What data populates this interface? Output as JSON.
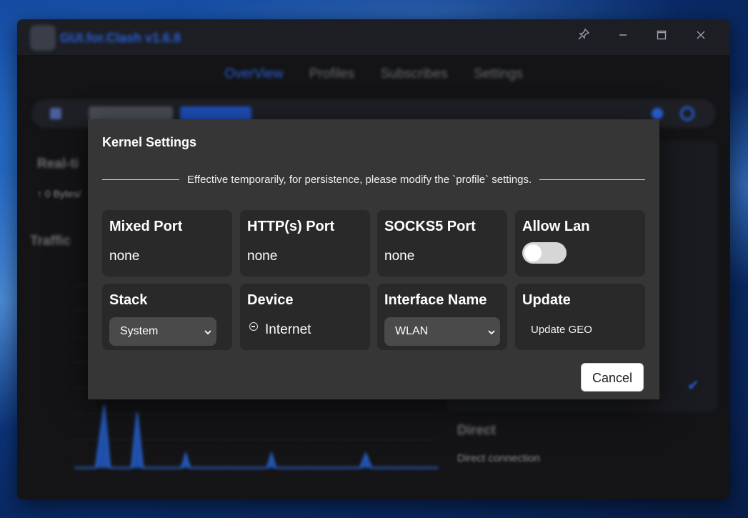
{
  "app": {
    "title": "GUI.for.Clash v1.6.8",
    "window_buttons": [
      "pin-icon",
      "minimize-icon",
      "maximize-icon",
      "close-icon"
    ]
  },
  "nav": {
    "tabs": [
      {
        "label": "OverView",
        "active": true
      },
      {
        "label": "Profiles",
        "active": false
      },
      {
        "label": "Subscribes",
        "active": false
      },
      {
        "label": "Settings",
        "active": false
      }
    ]
  },
  "background": {
    "realtime_heading": "Real-ti",
    "realtime_stat": "↑ 0 Bytes/",
    "traffic_heading": "Traffic",
    "direct_heading": "Direct",
    "direct_sub": "Direct connection"
  },
  "dialog": {
    "title": "Kernel Settings",
    "notice": "Effective temporarily, for persistence, please modify the `profile` settings.",
    "cards": {
      "mixed_port": {
        "label": "Mixed Port",
        "value": "none"
      },
      "http_port": {
        "label": "HTTP(s) Port",
        "value": "none"
      },
      "socks5_port": {
        "label": "SOCKS5 Port",
        "value": "none"
      },
      "allow_lan": {
        "label": "Allow Lan",
        "enabled": false
      },
      "stack": {
        "label": "Stack",
        "selected": "System"
      },
      "device": {
        "label": "Device",
        "value": "Internet"
      },
      "interface_name": {
        "label": "Interface Name",
        "selected": "WLAN"
      },
      "update": {
        "label": "Update",
        "action": "Update GEO"
      }
    },
    "cancel_label": "Cancel"
  },
  "colors": {
    "accent": "#2a5fd6",
    "dialog_bg": "#363636",
    "card_bg": "#292929"
  }
}
